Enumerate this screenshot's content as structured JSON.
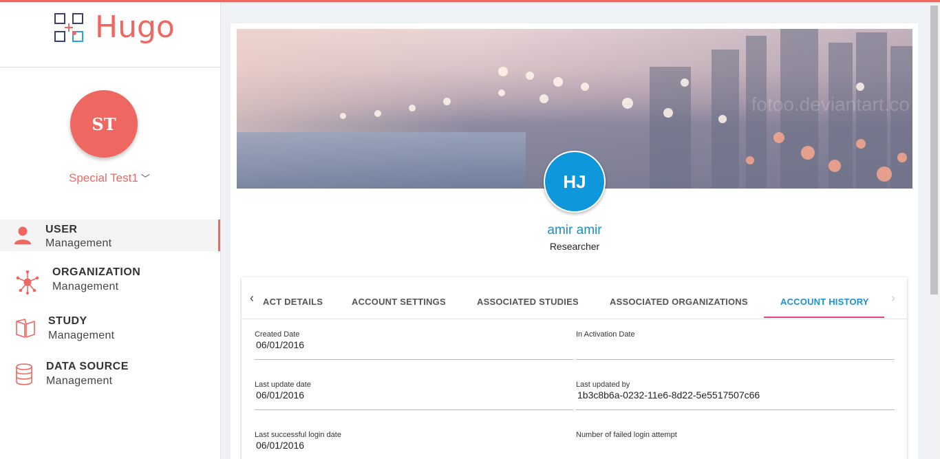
{
  "app": {
    "name": "Hugo",
    "brand_color": "#ee6760"
  },
  "sidebar": {
    "user": {
      "initials": "ST",
      "name": "Special Test1",
      "chevron_icon": "chevron-down-icon"
    },
    "items": [
      {
        "title": "USER",
        "subtitle": "Management",
        "icon": "user-icon",
        "active": true
      },
      {
        "title": "ORGANIZATION",
        "subtitle": "Management",
        "icon": "network-icon",
        "active": false
      },
      {
        "title": "STUDY",
        "subtitle": "Management",
        "icon": "book-icon",
        "active": false
      },
      {
        "title": "DATA SOURCE",
        "subtitle": "Management",
        "icon": "database-icon",
        "active": false
      }
    ]
  },
  "profile": {
    "banner_watermark": "fotoo.deviantart.co",
    "initials": "HJ",
    "name": "amir amir",
    "role": "Researcher",
    "avatar_color": "#0f97dc"
  },
  "tabs": {
    "items": [
      {
        "label": "ACT DETAILS",
        "active": false
      },
      {
        "label": "ACCOUNT SETTINGS",
        "active": false
      },
      {
        "label": "ASSOCIATED STUDIES",
        "active": false
      },
      {
        "label": "ASSOCIATED ORGANIZATIONS",
        "active": false
      },
      {
        "label": "ACCOUNT HISTORY",
        "active": true
      }
    ],
    "prev_icon": "chevron-left-icon",
    "next_icon": "chevron-right-icon",
    "active_color": "#1e8fd5",
    "underline_color": "#e0447c"
  },
  "history": {
    "created_date": {
      "label": "Created Date",
      "value": "06/01/2016"
    },
    "in_activation_date": {
      "label": "In Activation Date",
      "value": ""
    },
    "last_update_date": {
      "label": "Last update date",
      "value": "06/01/2016"
    },
    "last_updated_by": {
      "label": "Last updated by",
      "value": "1b3c8b6a-0232-11e6-8d22-5e5517507c66"
    },
    "last_login_date": {
      "label": "Last successful login date",
      "value": "06/01/2016"
    },
    "failed_login_attempts": {
      "label": "Number of failed login attempt",
      "value": ""
    }
  }
}
